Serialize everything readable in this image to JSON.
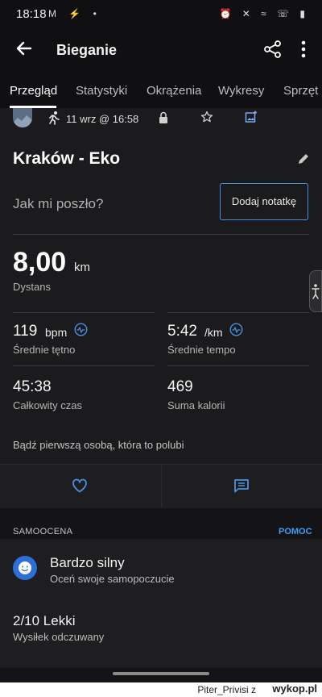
{
  "status": {
    "time": "18:18",
    "left_icons": "M ⚡ •",
    "right_icons": "⏰ ✕ ≈ ☏ ▮"
  },
  "appbar": {
    "title": "Bieganie",
    "back_icon": "arrow-left",
    "share_icon": "share",
    "more_icon": "more-vert"
  },
  "tabs": [
    "Przegląd",
    "Statystyki",
    "Okrążenia",
    "Wykresy",
    "Sprzęt"
  ],
  "meta": {
    "date": "11 wrz @ 16:58",
    "icons": [
      "running-icon",
      "lock-icon",
      "star-icon",
      "image-add-icon"
    ]
  },
  "activity": {
    "name": "Kraków - Eko",
    "notes_prompt": "Jak mi poszło?",
    "add_note_label": "Dodaj notatkę"
  },
  "stats": {
    "distance": {
      "value": "8,00",
      "unit": "km",
      "label": "Dystans"
    },
    "hr": {
      "value": "119",
      "unit": "bpm",
      "label": "Średnie tętno"
    },
    "pace": {
      "value": "5:42",
      "unit": "/km",
      "label": "Średnie tempo"
    },
    "time": {
      "value": "45:38",
      "label": "Całkowity czas"
    },
    "calories": {
      "value": "469",
      "label": "Suma kalorii"
    }
  },
  "social": {
    "like_prompt": "Bądź pierwszą osobą, która to polubi"
  },
  "self_eval": {
    "section_label": "SAMOOCENA",
    "help_label": "POMOC",
    "feeling_title": "Bardzo silny",
    "feeling_sub": "Oceń swoje samopoczucie",
    "rpe_title": "2/10 Lekki",
    "rpe_sub": "Wysiłek odczuwany"
  },
  "watermark": {
    "author": "Piter_Privisi z",
    "site": "wykop.pl"
  },
  "colors": {
    "accent": "#4a90e2",
    "link": "#3b9df5",
    "background": "#1b1b1d"
  }
}
